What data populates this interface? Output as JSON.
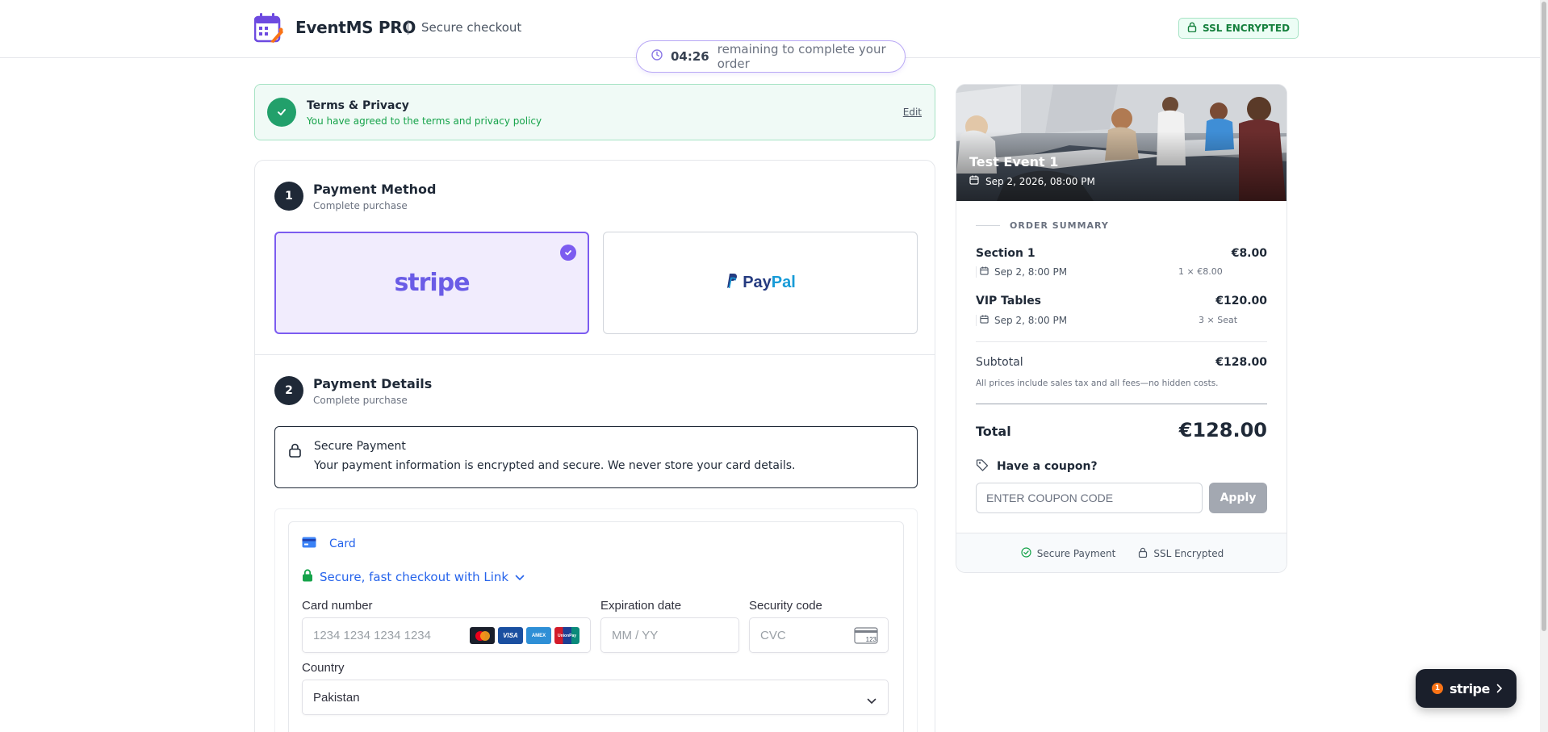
{
  "header": {
    "brand": "EventMS PRO",
    "subtitle": "Secure checkout",
    "ssl_badge": "SSL ENCRYPTED"
  },
  "timer": {
    "time": "04:26",
    "text": "remaining to complete your order"
  },
  "terms": {
    "title": "Terms & Privacy",
    "subtitle": "You have agreed to the terms and privacy policy",
    "edit_label": "Edit"
  },
  "payment_method": {
    "step": "1",
    "title": "Payment Method",
    "subtitle": "Complete purchase",
    "options": [
      {
        "label": "stripe",
        "selected": true
      },
      {
        "label_1": "Pay",
        "label_2": "Pal",
        "selected": false
      }
    ]
  },
  "payment_details": {
    "step": "2",
    "title": "Payment Details",
    "subtitle": "Complete purchase",
    "secure_title": "Secure Payment",
    "secure_text": "Your payment information is encrypted and secure. We never store your card details."
  },
  "stripe_form": {
    "card_tab": "Card",
    "link_text": "Secure, fast checkout with Link",
    "card_number_label": "Card number",
    "card_number_placeholder": "1234 1234 1234 1234",
    "expiry_label": "Expiration date",
    "expiry_placeholder": "MM / YY",
    "cvc_label": "Security code",
    "cvc_placeholder": "CVC",
    "country_label": "Country",
    "country_value": "Pakistan",
    "card_brands": [
      "mastercard-icon",
      "visa-icon",
      "amex-icon",
      "unionpay-icon"
    ],
    "visa_text": "VISA",
    "amex_text": "AMEX",
    "unionpay_text": "UnionPay",
    "cvc_icon_text": "123"
  },
  "summary": {
    "event_title": "Test Event 1",
    "event_date": "Sep 2, 2026, 08:00 PM",
    "heading": "ORDER SUMMARY",
    "items": [
      {
        "name": "Section 1",
        "price": "€8.00",
        "date": "Sep 2, 8:00 PM",
        "qty": "1 × €8.00"
      },
      {
        "name": "VIP Tables",
        "price": "€120.00",
        "date": "Sep 2, 8:00 PM",
        "qty": "3 × Seat"
      }
    ],
    "subtotal_label": "Subtotal",
    "subtotal_value": "€128.00",
    "tax_note": "All prices include sales tax and all fees—no hidden costs.",
    "total_label": "Total",
    "total_value": "€128.00",
    "coupon_label": "Have a coupon?",
    "coupon_placeholder": "ENTER COUPON CODE",
    "apply_label": "Apply",
    "footer_secure": "Secure Payment",
    "footer_ssl": "SSL Encrypted"
  },
  "stripe_badge": {
    "count": "1",
    "label": "stripe"
  },
  "colors": {
    "accent": "#7c5cf0",
    "success": "#22a06b",
    "link_blue": "#2563eb"
  }
}
